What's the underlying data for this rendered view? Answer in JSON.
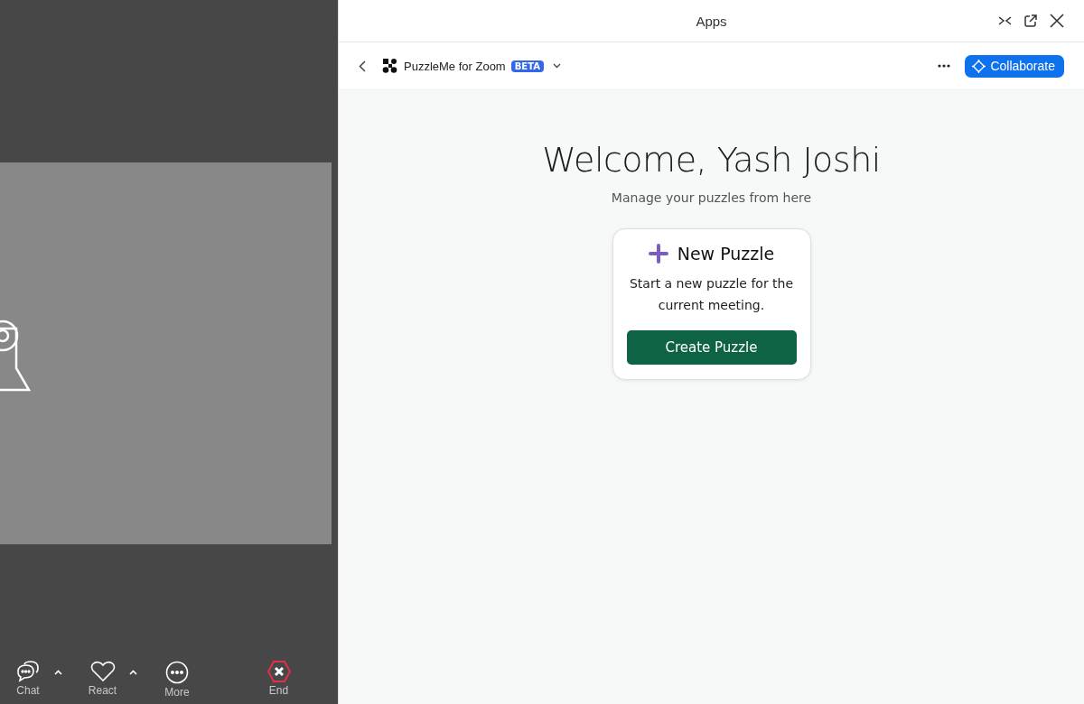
{
  "meeting": {
    "toolbar": [
      {
        "kind": "chat",
        "label": "Chat",
        "caret": true
      },
      {
        "kind": "react",
        "label": "React",
        "caret": true
      },
      {
        "kind": "more",
        "label": "More",
        "caret": false
      },
      {
        "kind": "end",
        "label": "End",
        "caret": false
      }
    ]
  },
  "panel": {
    "title": "Apps",
    "app_name": "PuzzleMe for Zoom",
    "badge": "BETA",
    "collaborate": "Collaborate",
    "heading": "Welcome, Yash Joshi",
    "subheading": "Manage your puzzles from here",
    "card": {
      "title": "New Puzzle",
      "text": "Start a new puzzle for the current meeting.",
      "button": "Create Puzzle"
    }
  }
}
